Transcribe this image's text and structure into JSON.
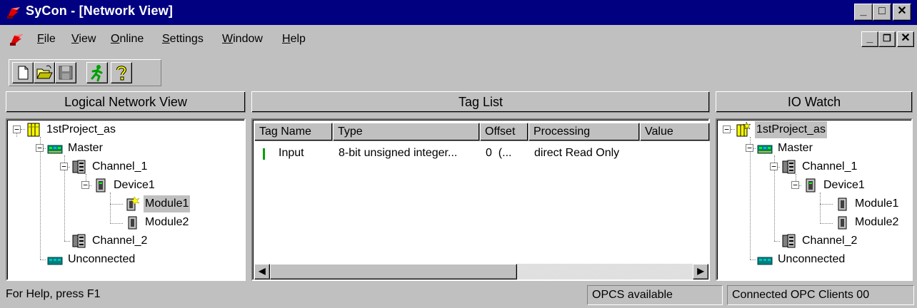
{
  "window": {
    "title": "SyCon - [Network View]"
  },
  "menu": {
    "items": [
      {
        "label": "File",
        "accel": "F"
      },
      {
        "label": "View",
        "accel": "V"
      },
      {
        "label": "Online",
        "accel": "O"
      },
      {
        "label": "Settings",
        "accel": "S"
      },
      {
        "label": "Window",
        "accel": "W"
      },
      {
        "label": "Help",
        "accel": "H"
      }
    ]
  },
  "toolbar": {
    "buttons": [
      "new-icon",
      "open-icon",
      "save-icon",
      "run-icon",
      "help-icon"
    ]
  },
  "panes": {
    "logical": {
      "title": "Logical Network View"
    },
    "taglist": {
      "title": "Tag List"
    },
    "iowatch": {
      "title": "IO Watch"
    }
  },
  "tree": {
    "project": "1stProject_as",
    "master": "Master",
    "channel1": "Channel_1",
    "device1": "Device1",
    "module1": "Module1",
    "module2": "Module2",
    "channel2": "Channel_2",
    "unconnected": "Unconnected"
  },
  "taglist": {
    "columns": [
      "Tag Name",
      "Type",
      "Offset",
      "Processing",
      "Value"
    ],
    "rows": [
      {
        "name": "Input",
        "type": "8-bit unsigned integer...",
        "offset": "0  (...",
        "processing": "direct Read Only",
        "value": ""
      }
    ]
  },
  "status": {
    "help": "For Help, press F1",
    "opcs": "OPCS available",
    "clients": "Connected OPC Clients 00"
  },
  "colors": {
    "titlebar": "#000080",
    "face": "#c0c0c0",
    "selection": "#c0c0c0"
  }
}
